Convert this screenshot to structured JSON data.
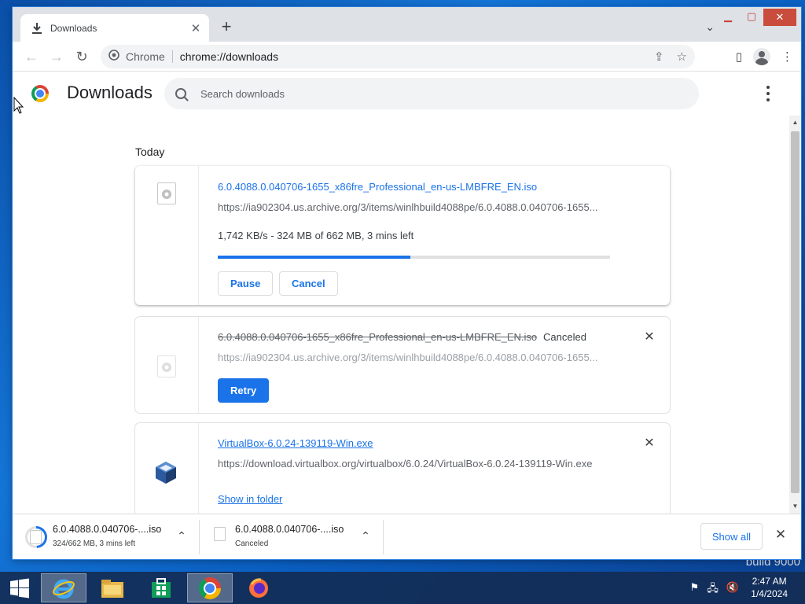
{
  "desktop": {
    "watermark": "build 9000"
  },
  "browser": {
    "tab_title": "Downloads",
    "new_tab_label": "+",
    "omnibox": {
      "site_label": "Chrome",
      "url": "chrome://downloads"
    }
  },
  "page": {
    "title": "Downloads",
    "search_placeholder": "Search downloads",
    "date_header": "Today"
  },
  "downloads": [
    {
      "filename": "6.0.4088.0.040706-1655_x86fre_Professional_en-us-LMBFRE_EN.iso",
      "url": "https://ia902304.us.archive.org/3/items/winlhbuild4088pe/6.0.4088.0.040706-1655...",
      "status": "1,742 KB/s - 324 MB of 662 MB, 3 mins left",
      "progress": 0.49,
      "pause_label": "Pause",
      "cancel_label": "Cancel"
    },
    {
      "filename": "6.0.4088.0.040706-1655_x86fre_Professional_en-us-LMBFRE_EN.iso",
      "state": "Canceled",
      "url": "https://ia902304.us.archive.org/3/items/winlhbuild4088pe/6.0.4088.0.040706-1655...",
      "retry_label": "Retry"
    },
    {
      "filename": "VirtualBox-6.0.24-139119-Win.exe",
      "url": "https://download.virtualbox.org/virtualbox/6.0.24/VirtualBox-6.0.24-139119-Win.exe",
      "link_label": "Show in folder"
    }
  ],
  "shelf": {
    "items": [
      {
        "name": "6.0.4088.0.040706-....iso",
        "status": "324/662 MB, 3 mins left",
        "progress": 0.49
      },
      {
        "name": "6.0.4088.0.040706-....iso",
        "status": "Canceled"
      }
    ],
    "show_all_label": "Show all"
  },
  "taskbar": {
    "time": "2:47 AM",
    "date": "1/4/2024"
  },
  "colors": {
    "accent": "#1a73e8",
    "desktop": "#0a64c8"
  }
}
